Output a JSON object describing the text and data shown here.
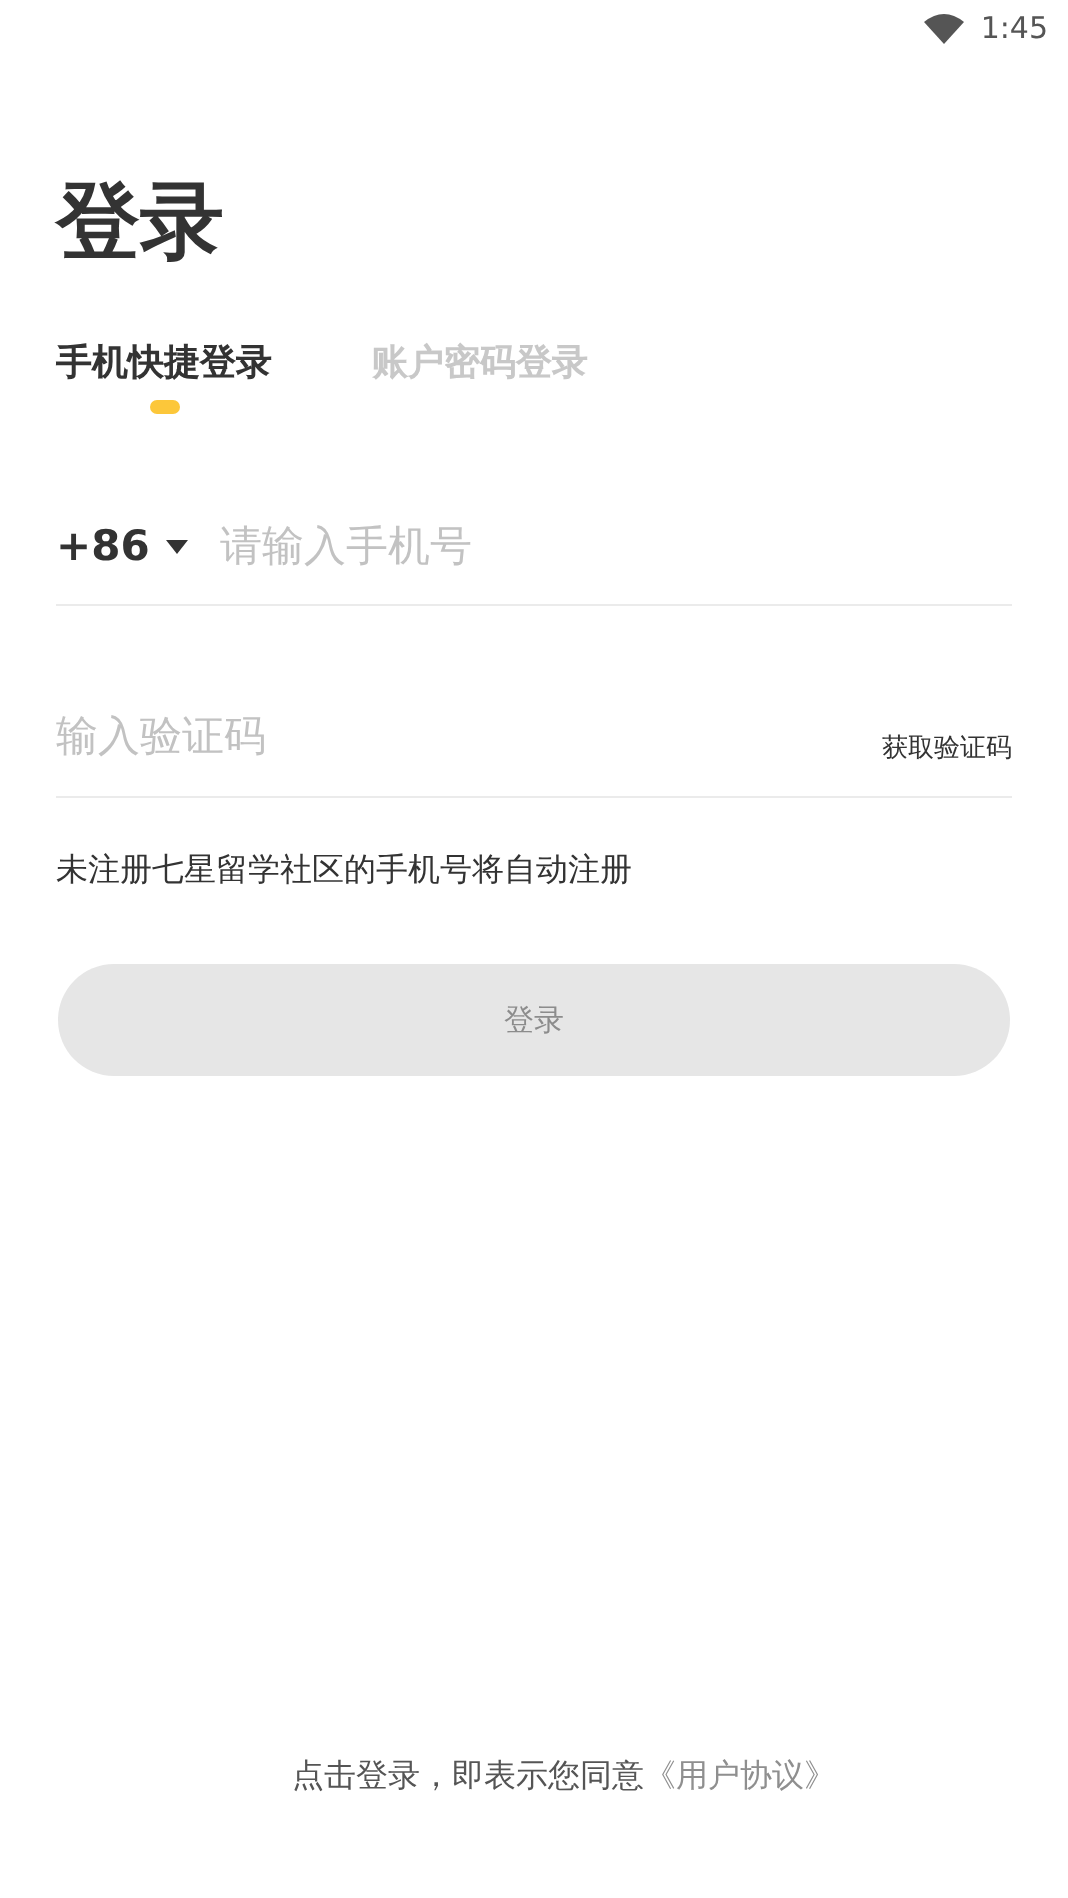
{
  "status_bar": {
    "time": "1:45"
  },
  "title": "登录",
  "tabs": [
    {
      "label": "手机快捷登录",
      "selected": true
    },
    {
      "label": "账户密码登录",
      "selected": false
    }
  ],
  "phone": {
    "country_code": "+86",
    "placeholder": "请输入手机号"
  },
  "code": {
    "placeholder": "输入验证码",
    "action": "获取验证码"
  },
  "note": "未注册七星留学社区的手机号将自动注册",
  "login_button": {
    "label": "登录",
    "disabled": true
  },
  "agreement": {
    "text": "点击登录，即表示您同意",
    "link": "《用户协议》"
  }
}
